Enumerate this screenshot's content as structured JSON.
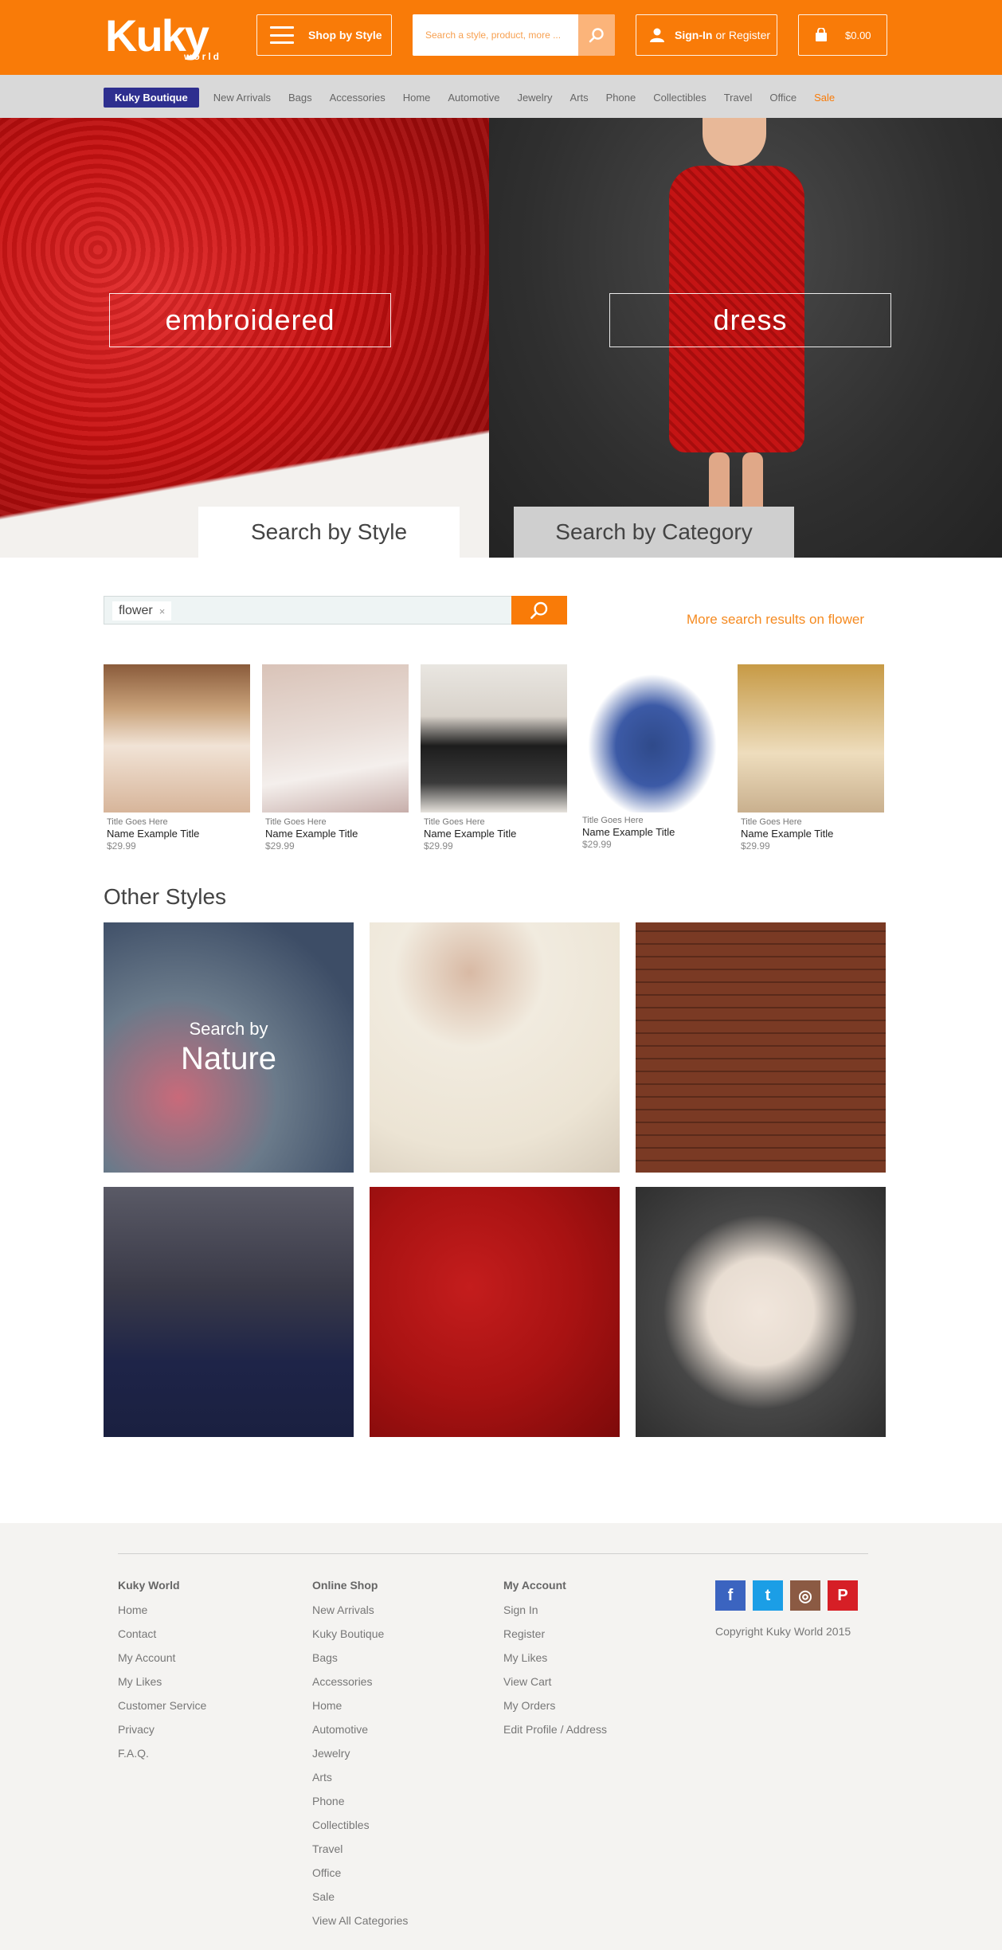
{
  "header": {
    "logo_main": "Kuky",
    "logo_sub": "world",
    "shop_by_style": "Shop by Style",
    "search_placeholder": "Search a style, product, more ...",
    "signin_bold": "Sign-In",
    "signin_or": "or",
    "signin_register": "Register",
    "cart_amount": "$0.00",
    "brand_color": "#f97b08"
  },
  "nav": {
    "items": [
      "Kuky Boutique",
      "New Arrivals",
      "Bags",
      "Accessories",
      "Home",
      "Automotive",
      "Jewelry",
      "Arts",
      "Phone",
      "Collectibles",
      "Travel",
      "Office",
      "Sale"
    ]
  },
  "hero": {
    "left_label": "embroidered",
    "right_label": "dress",
    "tab_style": "Search by Style",
    "tab_category": "Search by Category"
  },
  "search": {
    "tag": "flower",
    "tag_remove": "×",
    "more_results": "More search results on flower"
  },
  "products": [
    {
      "subtitle": "Title Goes Here",
      "name": "Name Example Title",
      "price": "$29.99"
    },
    {
      "subtitle": "Title Goes Here",
      "name": "Name Example Title",
      "price": "$29.99"
    },
    {
      "subtitle": "Title Goes Here",
      "name": "Name Example Title",
      "price": "$29.99"
    },
    {
      "subtitle": "Title Goes Here",
      "name": "Name Example Title",
      "price": "$29.99"
    },
    {
      "subtitle": "Title Goes Here",
      "name": "Name Example Title",
      "price": "$29.99"
    }
  ],
  "other_styles": {
    "title": "Other Styles",
    "nature_small": "Search by",
    "nature_big": "Nature"
  },
  "footer": {
    "col1": {
      "heading": "Kuky World",
      "links": [
        "Home",
        "Contact",
        "My Account",
        "My Likes",
        "Customer Service",
        "Privacy",
        "F.A.Q."
      ]
    },
    "col2": {
      "heading": "Online Shop",
      "links": [
        "New Arrivals",
        "Kuky Boutique",
        "Bags",
        "Accessories",
        "Home",
        "Automotive",
        "Jewelry",
        "Arts",
        "Phone",
        "Collectibles",
        "Travel",
        "Office",
        "Sale",
        "View All Categories"
      ]
    },
    "col3": {
      "heading": "My Account",
      "links": [
        "Sign In",
        "Register",
        "My Likes",
        "View Cart",
        "My Orders",
        "Edit Profile / Address"
      ]
    },
    "social": {
      "facebook": "f",
      "twitter": "t",
      "instagram": "◎",
      "pinterest": "P"
    },
    "copyright": "Copyright Kuky World 2015"
  }
}
